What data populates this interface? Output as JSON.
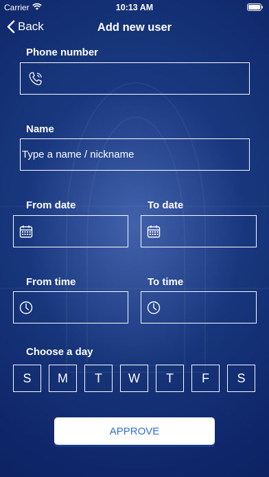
{
  "status_bar": {
    "carrier": "Carrier",
    "time": "10:13 AM"
  },
  "nav": {
    "back_label": "Back",
    "title": "Add new user"
  },
  "phone": {
    "label": "Phone number",
    "value": "",
    "icon": "phone-icon"
  },
  "name": {
    "label": "Name",
    "value": "",
    "placeholder": "Type a name / nickname"
  },
  "from_date": {
    "label": "From date",
    "value": "",
    "icon": "calendar-icon"
  },
  "to_date": {
    "label": "To date",
    "value": "",
    "icon": "calendar-icon"
  },
  "from_time": {
    "label": "From time",
    "value": "",
    "icon": "clock-icon"
  },
  "to_time": {
    "label": "To time",
    "value": "",
    "icon": "clock-icon"
  },
  "days": {
    "label": "Choose a day",
    "items": [
      "S",
      "M",
      "T",
      "W",
      "T",
      "F",
      "S"
    ]
  },
  "approve_label": "APPROVE",
  "colors": {
    "background": "#17357a",
    "accent": "#2f6fd6",
    "foreground": "#ffffff"
  }
}
